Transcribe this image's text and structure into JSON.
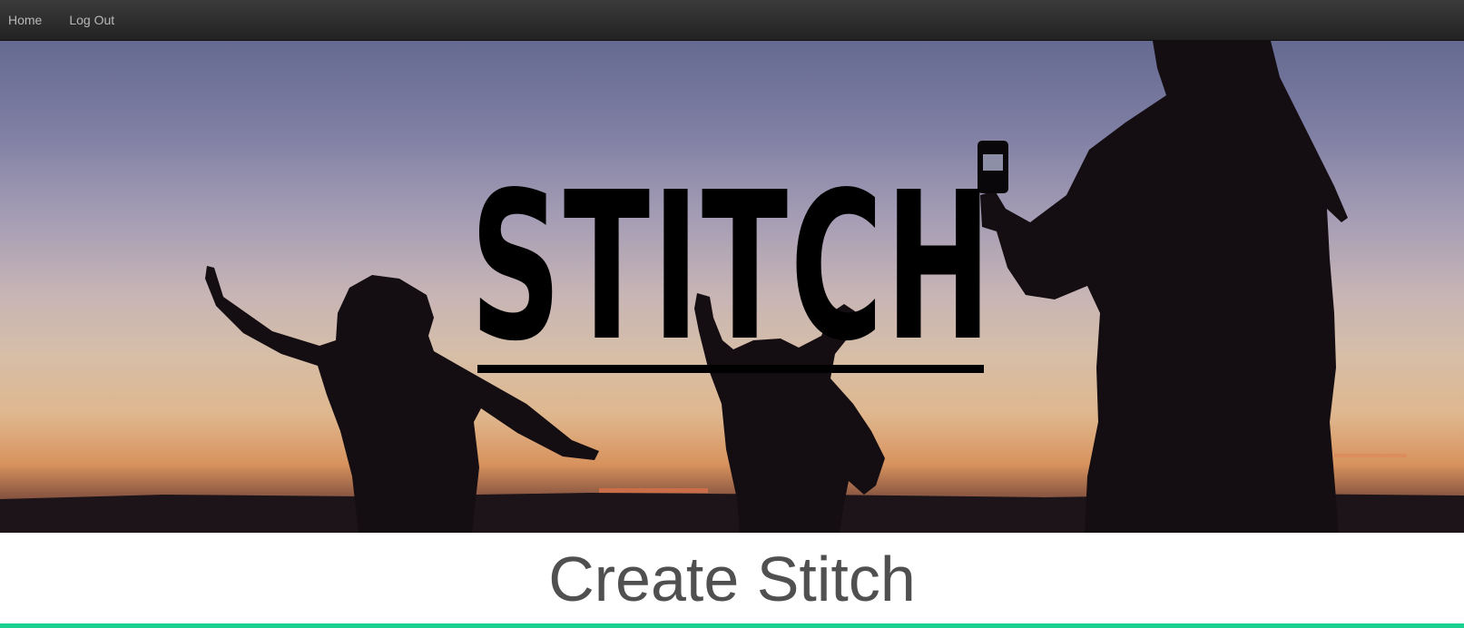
{
  "nav": {
    "home_label": "Home",
    "logout_label": "Log Out"
  },
  "hero": {
    "title": "STITCH"
  },
  "main": {
    "heading": "Create Stitch"
  },
  "colors": {
    "navbar": "#2b2b2b",
    "nav_text": "#b9b9b9",
    "heading_text": "#505050",
    "accent": "#1ad18f"
  }
}
